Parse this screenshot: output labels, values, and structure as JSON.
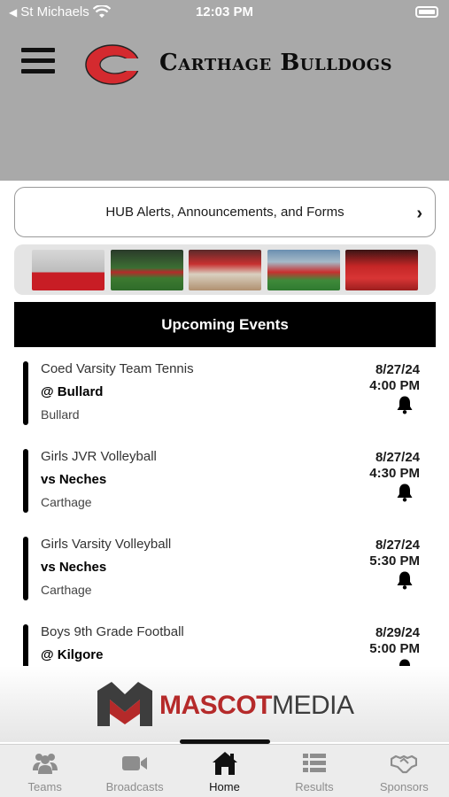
{
  "status_bar": {
    "carrier": "St Michaels",
    "time": "12:03 PM"
  },
  "header": {
    "title": "Carthage Bulldogs",
    "logo_letter": "C",
    "brand_color": "#d42a2f"
  },
  "alerts": {
    "label": "HUB Alerts, Announcements, and Forms",
    "chevron": "›"
  },
  "photos": [
    {
      "name": "photo-1"
    },
    {
      "name": "photo-2"
    },
    {
      "name": "photo-3"
    },
    {
      "name": "photo-4"
    },
    {
      "name": "photo-5"
    }
  ],
  "events_section": {
    "title": "Upcoming Events"
  },
  "events": [
    {
      "sport": "Coed Varsity Team Tennis",
      "opponent": "@ Bullard",
      "location": "Bullard",
      "date": "8/27/24",
      "time": "4:00 PM"
    },
    {
      "sport": "Girls JVR Volleyball",
      "opponent": "vs Neches",
      "location": "Carthage",
      "date": "8/27/24",
      "time": "4:30 PM"
    },
    {
      "sport": "Girls Varsity Volleyball",
      "opponent": "vs Neches",
      "location": "Carthage",
      "date": "8/27/24",
      "time": "5:30 PM"
    },
    {
      "sport": "Boys 9th Grade Football",
      "opponent": "@ Kilgore",
      "location": "",
      "date": "8/29/24",
      "time": "5:00 PM"
    }
  ],
  "sponsor_banner": {
    "text_a": "MASCOT",
    "text_b": "MEDIA",
    "color_a": "#b52a2a",
    "color_b": "#3d3d3d"
  },
  "tabs": [
    {
      "label": "Teams",
      "icon": "teams-icon",
      "active": false
    },
    {
      "label": "Broadcasts",
      "icon": "video-camera-icon",
      "active": false
    },
    {
      "label": "Home",
      "icon": "home-icon",
      "active": true
    },
    {
      "label": "Results",
      "icon": "results-list-icon",
      "active": false
    },
    {
      "label": "Sponsors",
      "icon": "handshake-icon",
      "active": false
    }
  ]
}
